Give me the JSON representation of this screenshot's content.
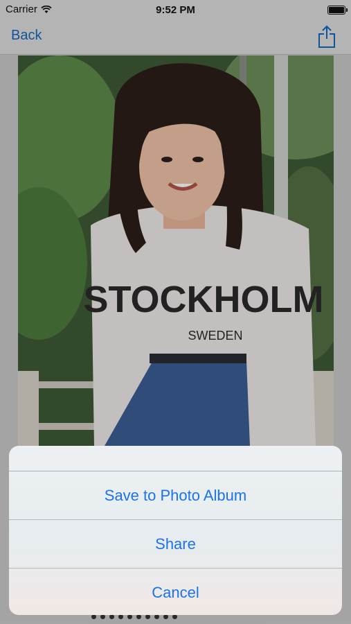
{
  "status_bar": {
    "carrier": "Carrier",
    "time": "9:52 PM"
  },
  "nav": {
    "back_label": "Back",
    "share_icon": "share-icon"
  },
  "photo": {
    "shirt_text": "STOCKHOLM",
    "shirt_subtext": "SWEDEN"
  },
  "page_dots_count": 10,
  "action_sheet": {
    "actions": [
      {
        "label": "Save to Photo Album"
      },
      {
        "label": "Share"
      },
      {
        "label": "Cancel"
      }
    ]
  },
  "colors": {
    "accent": "#1a73e8",
    "nav_accent": "#1565c0"
  }
}
